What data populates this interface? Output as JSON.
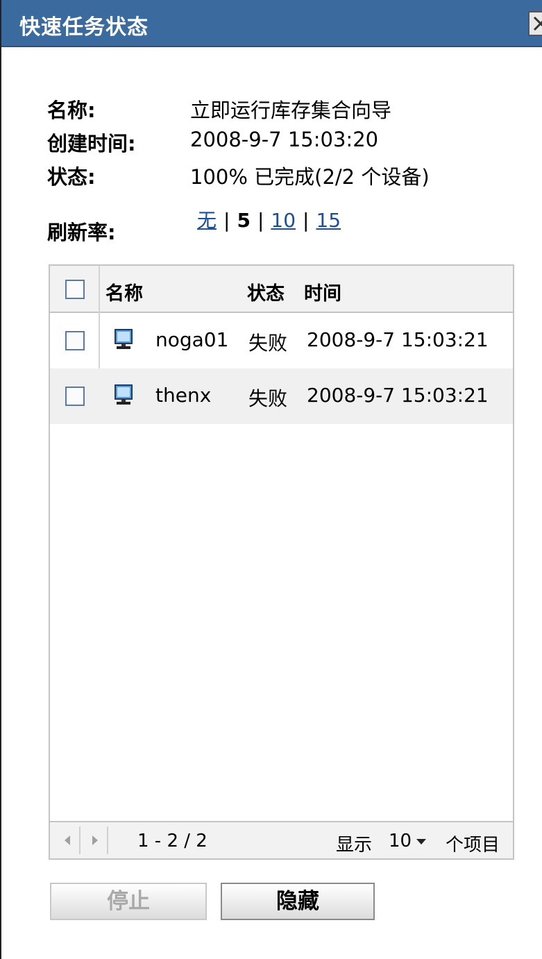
{
  "window": {
    "title": "快速任务状态",
    "close_icon": "close-icon"
  },
  "info": {
    "name_label": "名称:",
    "name_value": "立即运行库存集合向导",
    "created_label": "创建时间:",
    "created_value": "2008-9-7 15:03:20",
    "status_label": "状态:",
    "status_value": "100% 已完成(2/2 个设备)"
  },
  "refresh": {
    "label": "刷新率:",
    "options": [
      {
        "label": "无",
        "link": true
      },
      {
        "label": "5",
        "link": false
      },
      {
        "label": "10",
        "link": true
      },
      {
        "label": "15",
        "link": true
      }
    ],
    "separator": "|",
    "selected": "5"
  },
  "table": {
    "headers": {
      "name": "名称",
      "status": "状态",
      "time": "时间"
    },
    "rows": [
      {
        "name": "noga01",
        "status": "失败",
        "time": "2008-9-7 15:03:21",
        "icon": "computer-icon"
      },
      {
        "name": "thenx",
        "status": "失败",
        "time": "2008-9-7 15:03:21",
        "icon": "computer-icon"
      }
    ]
  },
  "pager": {
    "range": "1 - 2 / 2",
    "show_label": "显示",
    "page_size": "10",
    "items_label": "个项目"
  },
  "buttons": {
    "stop": "停止",
    "hide": "隐藏"
  },
  "colors": {
    "titlebar": "#3a6a9e",
    "link": "#1b4f99"
  }
}
